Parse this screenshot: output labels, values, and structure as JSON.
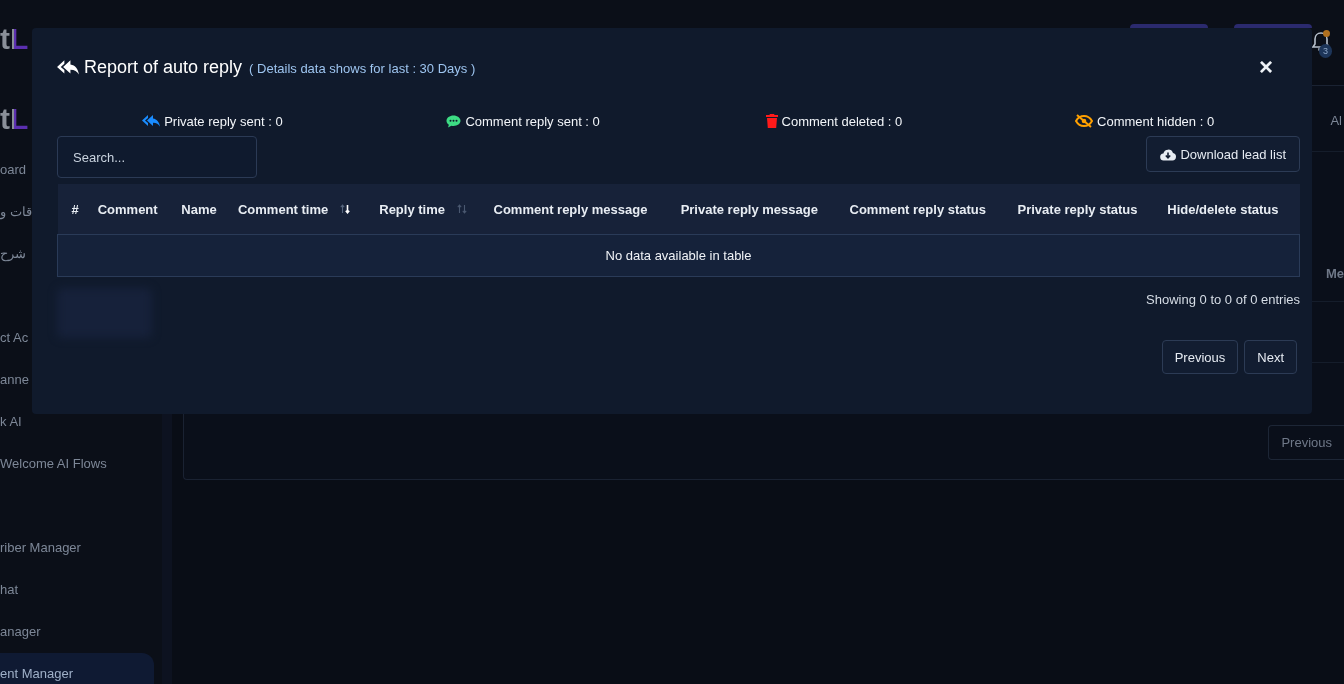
{
  "app": {
    "logos": [
      "tL",
      "tL"
    ],
    "header": {
      "notification_count": "3"
    },
    "sidebar": {
      "groups": [
        [
          {
            "label": "oard",
            "selected": false
          },
          {
            "label": "قات و",
            "selected": false
          },
          {
            "label": "شرح",
            "selected": false
          }
        ],
        [
          {
            "label": "ct Ac",
            "selected": false
          },
          {
            "label": "anne",
            "selected": false
          },
          {
            "label": "k AI",
            "selected": false
          },
          {
            "label": "Welcome AI Flows",
            "selected": false
          }
        ],
        [
          {
            "label": "riber Manager",
            "selected": false
          },
          {
            "label": "hat",
            "selected": false
          },
          {
            "label": "anager",
            "selected": false
          },
          {
            "label": "ent Manager",
            "selected": true
          }
        ]
      ]
    },
    "card": {
      "top_text": "Al",
      "column_text": "Me",
      "previous_button": "Previous"
    }
  },
  "modal": {
    "title": "Report of auto reply",
    "subtitle": "( Details data shows for last : 30 Days )",
    "close": "×",
    "stats": [
      {
        "kind": "private",
        "label": "Private reply sent : 0",
        "color": "#1a8cff"
      },
      {
        "kind": "comment",
        "label": "Comment reply sent : 0",
        "color": "#3ddc84"
      },
      {
        "kind": "deleted",
        "label": "Comment deleted : 0",
        "color": "#ff1a1a"
      },
      {
        "kind": "hidden",
        "label": "Comment hidden : 0",
        "color": "#ffa000"
      }
    ],
    "search": {
      "placeholder": "Search..."
    },
    "download_button": "Download lead list",
    "columns": [
      {
        "label": "#"
      },
      {
        "label": "Comment"
      },
      {
        "label": "Name"
      },
      {
        "label": "Comment time",
        "sorted": true
      },
      {
        "label": "Reply time",
        "sorted": false
      },
      {
        "label": "Comment reply message"
      },
      {
        "label": "Private reply message"
      },
      {
        "label": "Comment reply status"
      },
      {
        "label": "Private reply status"
      },
      {
        "label": "Hide/delete status"
      }
    ],
    "empty_message": "No data available in table",
    "info": "Showing 0 to 0 of 0 entries",
    "pagination": [
      "Previous",
      "Next"
    ]
  }
}
